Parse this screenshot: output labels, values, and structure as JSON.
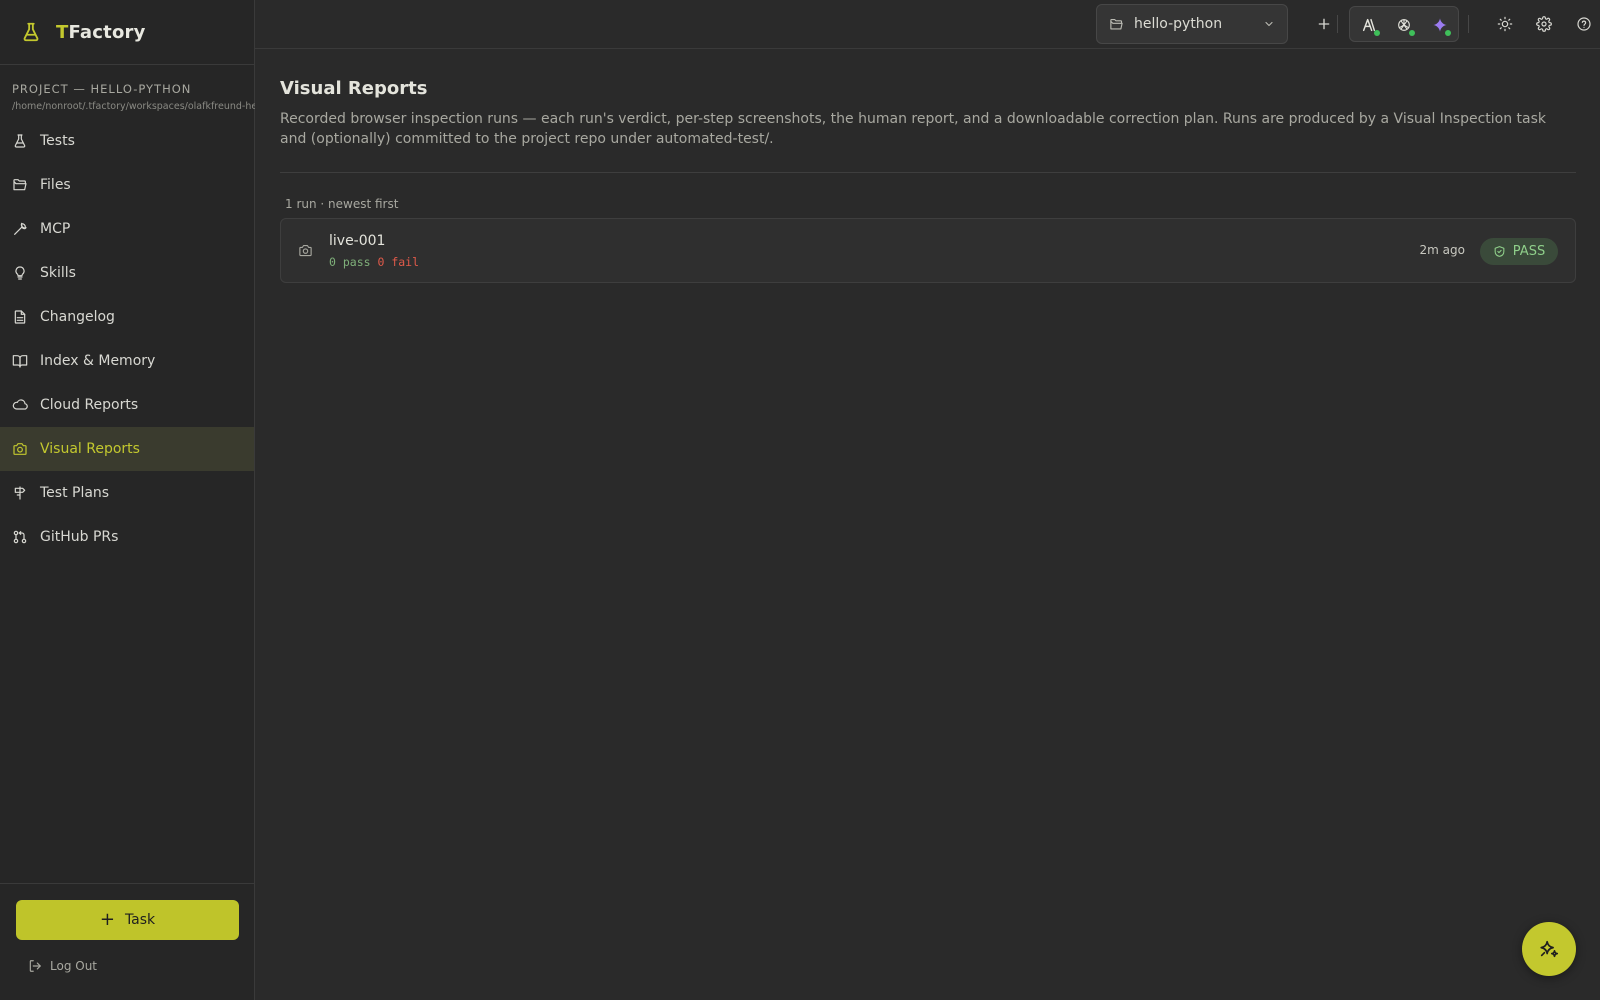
{
  "app": {
    "brand_prefix": "T",
    "brand_rest": "Factory"
  },
  "sidebar": {
    "project_label": "PROJECT — HELLO-PYTHON",
    "project_path": "/home/nonroot/.tfactory/workspaces/olafkfreund-hello-python",
    "items": [
      {
        "label": "Tests",
        "icon": "flask-icon"
      },
      {
        "label": "Files",
        "icon": "folder-open-icon"
      },
      {
        "label": "MCP",
        "icon": "wrench-icon"
      },
      {
        "label": "Skills",
        "icon": "lightbulb-icon"
      },
      {
        "label": "Changelog",
        "icon": "file-text-icon"
      },
      {
        "label": "Index & Memory",
        "icon": "book-open-icon"
      },
      {
        "label": "Cloud Reports",
        "icon": "cloud-icon"
      },
      {
        "label": "Visual Reports",
        "icon": "camera-icon",
        "active": true
      },
      {
        "label": "Test Plans",
        "icon": "signpost-icon"
      },
      {
        "label": "GitHub PRs",
        "icon": "git-pull-request-icon"
      }
    ],
    "task_button": "Task",
    "logout": "Log Out"
  },
  "topbar": {
    "project_select": "hello-python"
  },
  "main": {
    "title": "Visual Reports",
    "description": "Recorded browser inspection runs — each run's verdict, per-step screenshots, the human report, and a downloadable correction plan. Runs are produced by a Visual Inspection task and (optionally) committed to the project repo under automated-test/.",
    "run_count": "1 run · newest first",
    "runs": [
      {
        "name": "live-001",
        "pass": "0 pass",
        "fail": "0 fail",
        "time": "2m ago",
        "verdict": "PASS"
      }
    ]
  },
  "colors": {
    "accent": "#c3c82e",
    "pass": "#7fb07a",
    "fail": "#e05a4a",
    "background": "#2a2a2a"
  }
}
